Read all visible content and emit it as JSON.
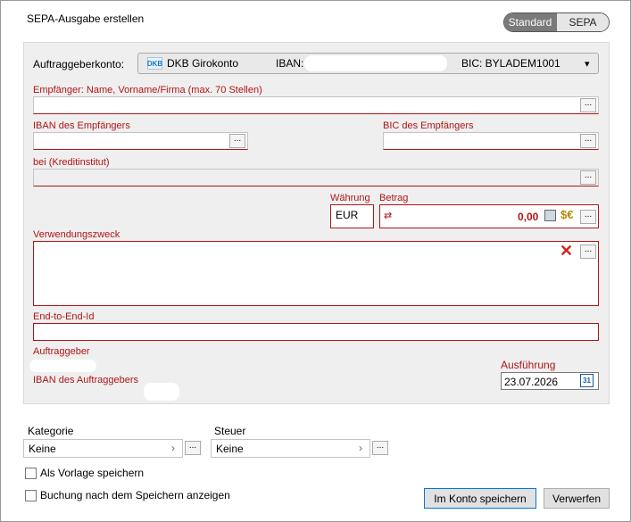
{
  "window": {
    "title": "SEPA-Ausgabe erstellen"
  },
  "mode_toggle": {
    "standard": "Standard",
    "sepa": "SEPA"
  },
  "account": {
    "label": "Auftraggeberkonto:",
    "logo_text": "DKB",
    "name": "DKB Girokonto",
    "iban_label": "IBAN:",
    "bic": "BIC: BYLADEM1001",
    "dropdown_arrow": "▾"
  },
  "recipient": {
    "label": "Empfänger: Name, Vorname/Firma (max. 70 Stellen)"
  },
  "iban": {
    "label": "IBAN des Empfängers"
  },
  "bic": {
    "label": "BIC des Empfängers"
  },
  "bank": {
    "label": "bei (Kreditinstitut)"
  },
  "currency": {
    "label": "Währung",
    "value": "EUR"
  },
  "amount": {
    "label": "Betrag",
    "value": "0,00"
  },
  "purpose": {
    "label": "Verwendungszweck"
  },
  "e2e": {
    "label": "End-to-End-Id"
  },
  "payer": {
    "label": "Auftraggeber",
    "iban_label": "IBAN des Auftraggebers"
  },
  "execution": {
    "label": "Ausführung",
    "date": "23.07.2026",
    "calendar_day": "31"
  },
  "category": {
    "label": "Kategorie",
    "value": "Keine"
  },
  "tax": {
    "label": "Steuer",
    "value": "Keine"
  },
  "options": {
    "save_template": "Als Vorlage speichern",
    "show_after_save": "Buchung nach dem Speichern anzeigen"
  },
  "buttons": {
    "save": "Im Konto speichern",
    "discard": "Verwerfen",
    "more": "..."
  },
  "colors": {
    "accent_red": "#b01515",
    "primary_blue": "#0078d7"
  }
}
